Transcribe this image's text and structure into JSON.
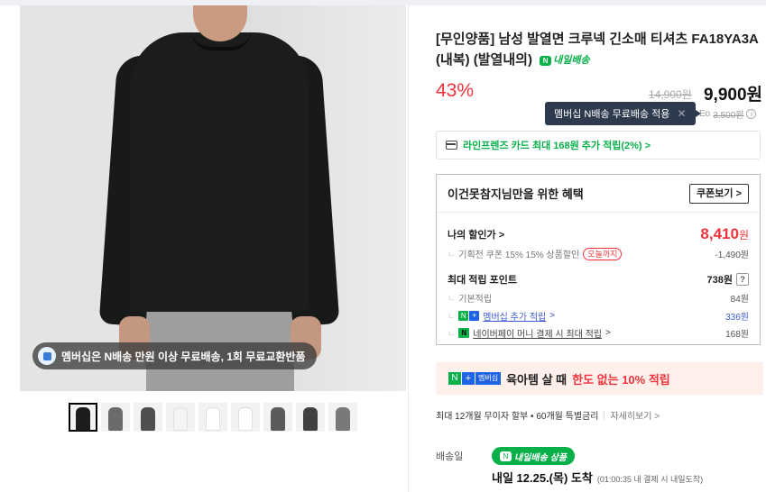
{
  "colors": {
    "accent_red": "#f1333b",
    "naver_green": "#08b04a",
    "link_blue": "#3d5bd1",
    "tooltip_bg": "#2e3a4e"
  },
  "gallery": {
    "badge_text": "멤버십은 N배송 만원 이상 무료배송, 1회 무료교환반품",
    "thumbnail_colors": [
      "#1b1d1c",
      "#6a6c6b",
      "#4d504e",
      "#f4f4f4",
      "#ffffff",
      "#ffffff",
      "#5a5c5b",
      "#3f4241",
      "#787a79"
    ]
  },
  "product": {
    "title": "[무인양품] 남성 발열면 크루넥 긴소매 티셔츠 FA18YA3A (내복) (발열내의)",
    "ship_tag": "내일배송",
    "ship_tag_icon": "N",
    "discount_rate": "43%",
    "original_price": "14,900원",
    "sale_price": "9,900원"
  },
  "tooltip": {
    "text": "멤버십 N배송 무료배송 적용",
    "close": "✕"
  },
  "shipping_fee": {
    "label": "Eo",
    "amount": "3,500원",
    "info": "i"
  },
  "card_banner": {
    "text": "라인프렌즈 카드 최대 168원 추가 적립(2%) >"
  },
  "benefits": {
    "title": "이건못참지님만을 위한 혜택",
    "coupon_button": "쿠폰보기 >",
    "my_discount_label": "나의 할인가 >",
    "my_price": "8,410",
    "my_price_unit": "원",
    "coupon_label": "기획전 쿠폰 15% 15% 상품할인",
    "coupon_tag": "오늘까지",
    "coupon_value": "-1,490원",
    "max_points_label": "최대 적립 포인트",
    "max_points_value": "738원",
    "question": "?",
    "base_points_label": "기본적립",
    "base_points_value": "84원",
    "membership_label": "멤버십 추가 적립",
    "membership_arrow": ">",
    "membership_value": "336원",
    "naverpay_label": "네이버페이 머니 결제 시 최대 적립",
    "naverpay_arrow": ">",
    "naverpay_value": "168원",
    "tree": "ㄴ",
    "n_letter": "N",
    "plus": "+"
  },
  "promo": {
    "membership_badge": "멤버십",
    "text": "육아템 살 때",
    "highlight": "한도 없는 10% 적립"
  },
  "installment": {
    "text": "최대 12개월 무이자 할부 • 60개월 특별금리",
    "more": "자세히보기 >"
  },
  "delivery": {
    "label": "배송일",
    "pill": "내일배송 상품",
    "arrival": "내일 12.25.(목) 도착",
    "arrival_note": "(01:00:35 내 결제 시 내일도착)"
  }
}
